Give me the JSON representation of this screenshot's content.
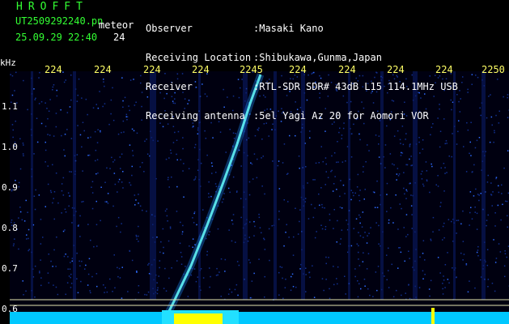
{
  "header": {
    "brand": "HROFFT",
    "filename": "UT2509292240.pn",
    "meteor_label": "meteor",
    "timestamp": "25.09.29 22:40",
    "meteor_count": "24",
    "fields": [
      {
        "label": "Observer",
        "value": ":Masaki Kano"
      },
      {
        "label": "Receiving Location",
        "value": ":Shibukawa,Gunma,Japan"
      },
      {
        "label": "Receiver",
        "value": ":RTL-SDR SDR# 43dB L15 114.1MHz USB"
      },
      {
        "label": "Receiving antenna",
        "value": ":5el Yagi Az 20 for Aomori VOR"
      }
    ]
  },
  "spectrogram": {
    "y_unit": "kHz",
    "x_ticks": [
      "224",
      "224",
      "224",
      "224",
      "2245",
      "224",
      "224",
      "224",
      "224",
      "2250"
    ],
    "y_ticks": [
      "1.1",
      "1.0",
      "0.9",
      "0.8",
      "0.7",
      "0.6"
    ],
    "colors": {
      "background": "#000000",
      "signal": "#00ffff",
      "noise": "#1133aa",
      "text_green": "#33ff33",
      "text_yellow": "#ffff66"
    }
  }
}
